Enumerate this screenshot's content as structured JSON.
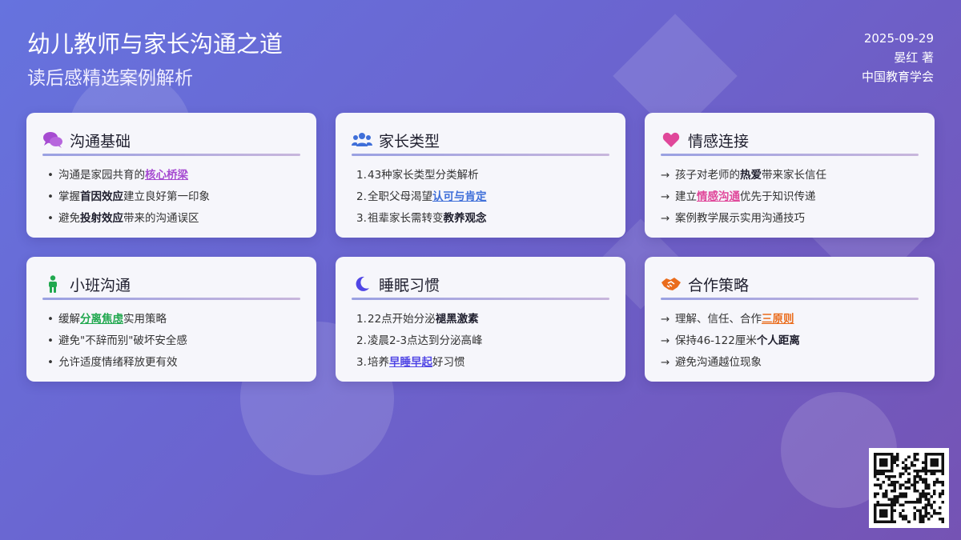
{
  "header": {
    "title": "幼儿教师与家长沟通之道",
    "subtitle": "读后感精选案例解析",
    "date": "2025-09-29",
    "author": "晏红 著",
    "publisher": "中国教育学会"
  },
  "colors": {
    "accent_purple": "#a64bd1",
    "accent_blue": "#3f6fd9",
    "accent_pink": "#e0479a",
    "accent_green": "#21a84f",
    "accent_indigo": "#5046e5",
    "accent_orange": "#ea6c1c"
  },
  "cards": [
    {
      "title": "沟通基础",
      "icon": "chat-bubbles-icon",
      "items": [
        {
          "parts": [
            {
              "t": "沟通是家园共育的"
            },
            {
              "t": "核心桥梁",
              "link": "#a64bd1"
            }
          ]
        },
        {
          "parts": [
            {
              "t": "掌握"
            },
            {
              "t": "首因效应",
              "b": true
            },
            {
              "t": "建立良好第一印象"
            }
          ]
        },
        {
          "parts": [
            {
              "t": "避免"
            },
            {
              "t": "投射效应",
              "b": true
            },
            {
              "t": "带来的沟通误区"
            }
          ]
        }
      ]
    },
    {
      "title": "家长类型",
      "icon": "users-icon",
      "items": [
        {
          "parts": [
            {
              "t": "43种家长类型分类解析"
            }
          ]
        },
        {
          "parts": [
            {
              "t": "全职父母渴望"
            },
            {
              "t": "认可与肯定",
              "link": "#3f6fd9"
            }
          ]
        },
        {
          "parts": [
            {
              "t": "祖辈家长需转变"
            },
            {
              "t": "教养观念",
              "b": true
            }
          ]
        }
      ]
    },
    {
      "title": "情感连接",
      "icon": "heart-icon",
      "items": [
        {
          "parts": [
            {
              "t": "孩子对老师的"
            },
            {
              "t": "热爱",
              "b": true
            },
            {
              "t": "带来家长信任"
            }
          ]
        },
        {
          "parts": [
            {
              "t": "建立"
            },
            {
              "t": "情感沟通",
              "link": "#e0479a"
            },
            {
              "t": "优先于知识传递"
            }
          ]
        },
        {
          "parts": [
            {
              "t": "案例教学展示实用沟通技巧"
            }
          ]
        }
      ]
    },
    {
      "title": "小班沟通",
      "icon": "child-icon",
      "items": [
        {
          "parts": [
            {
              "t": "缓解"
            },
            {
              "t": "分离焦虑",
              "link": "#21a84f"
            },
            {
              "t": "实用策略"
            }
          ]
        },
        {
          "parts": [
            {
              "t": "避免\"不辞而别\"破坏安全感"
            }
          ]
        },
        {
          "parts": [
            {
              "t": "允许适度情绪释放更有效"
            }
          ]
        }
      ]
    },
    {
      "title": "睡眠习惯",
      "icon": "moon-icon",
      "items": [
        {
          "parts": [
            {
              "t": "22点开始分泌"
            },
            {
              "t": "褪黑激素",
              "b": true
            }
          ]
        },
        {
          "parts": [
            {
              "t": "凌晨2-3点达到分泌高峰"
            }
          ]
        },
        {
          "parts": [
            {
              "t": "培养"
            },
            {
              "t": "早睡早起",
              "link": "#5046e5"
            },
            {
              "t": "好习惯"
            }
          ]
        }
      ]
    },
    {
      "title": "合作策略",
      "icon": "handshake-icon",
      "items": [
        {
          "parts": [
            {
              "t": "理解、信任、合作"
            },
            {
              "t": "三原则",
              "link": "#ea6c1c"
            }
          ]
        },
        {
          "parts": [
            {
              "t": "保持46-122厘米"
            },
            {
              "t": "个人距离",
              "b": true
            }
          ]
        },
        {
          "parts": [
            {
              "t": "避免沟通越位现象"
            }
          ]
        }
      ]
    }
  ],
  "qr": {
    "icon": "qr-code-icon"
  }
}
